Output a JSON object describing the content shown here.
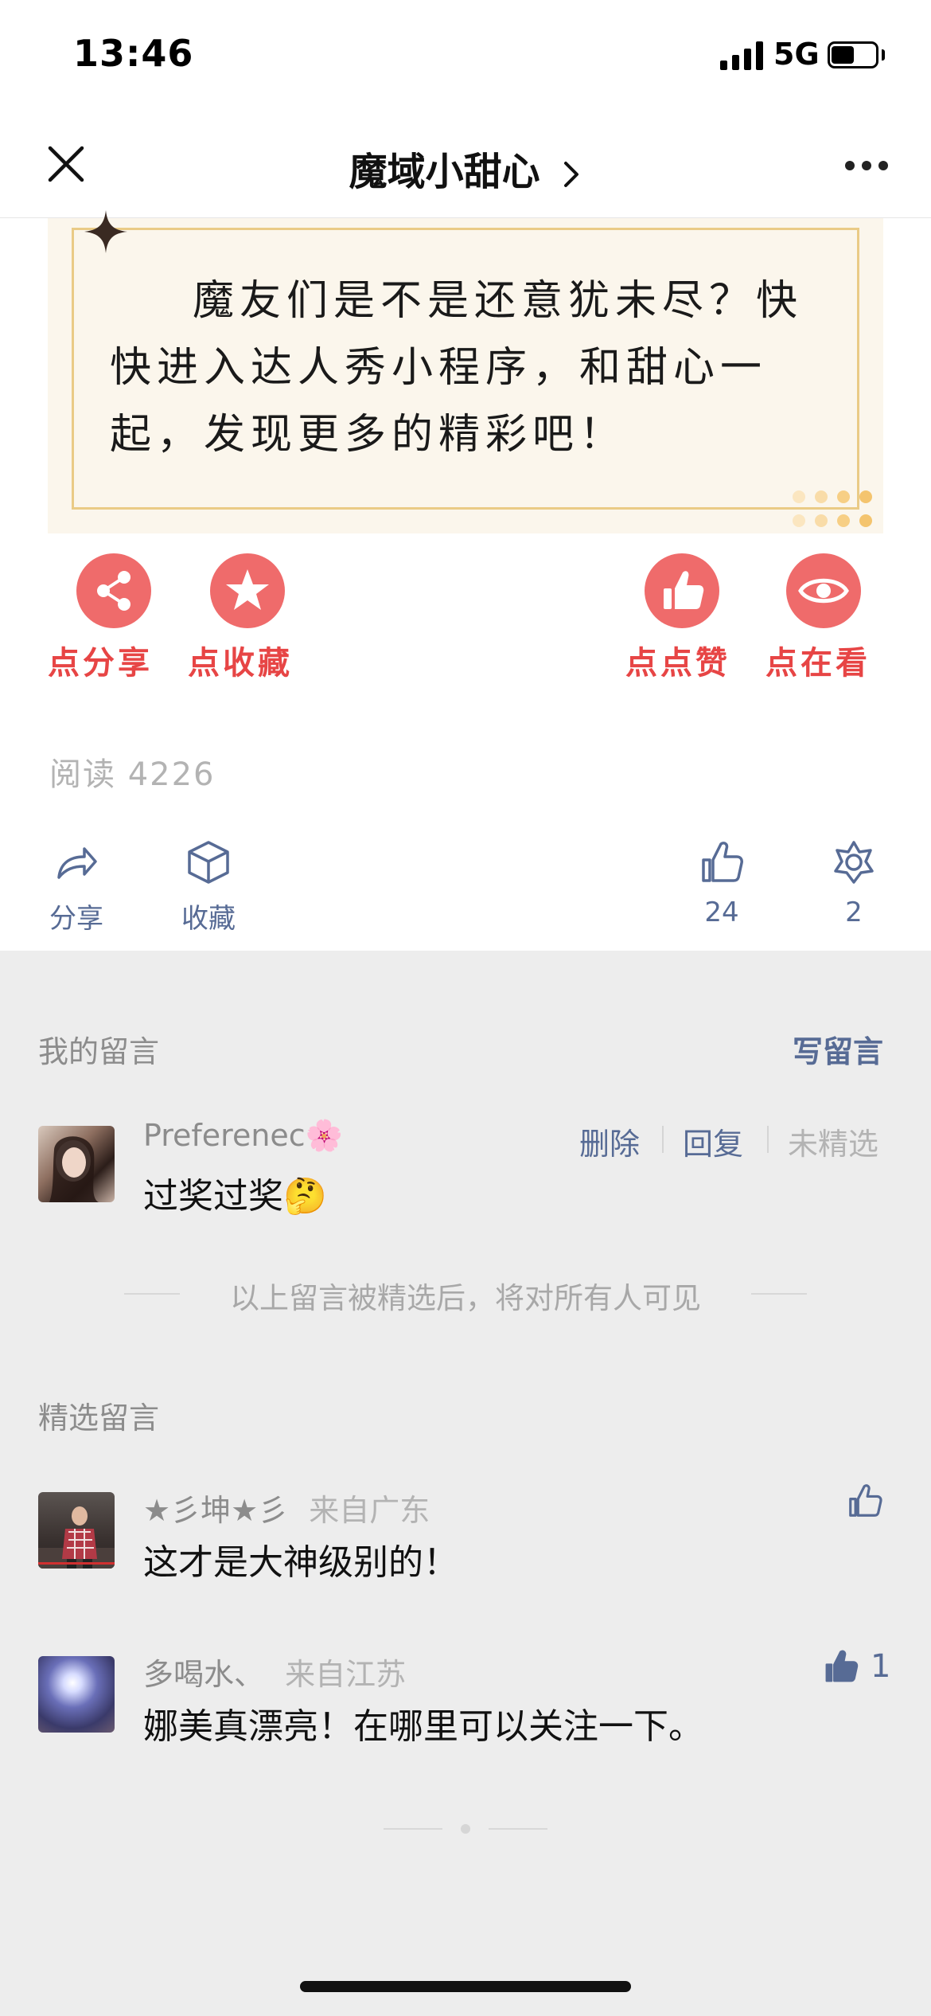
{
  "status_bar": {
    "time": "13:46",
    "network": "5G"
  },
  "nav": {
    "title": "魔域小甜心"
  },
  "article": {
    "card_text": "魔友们是不是还意犹未尽？快快进入达人秀小程序，和甜心一起，发现更多的精彩吧！",
    "actions": [
      "点分享",
      "点收藏",
      "点点赞",
      "点在看"
    ],
    "read_label": "阅读 4226"
  },
  "toolbar": {
    "share": "分享",
    "collect": "收藏",
    "like_count": "24",
    "wow_count": "2"
  },
  "my_comments": {
    "title": "我的留言",
    "write": "写留言",
    "item": {
      "name": "Preferenec",
      "flower": "🌸",
      "text": "过奖过奖",
      "emoji": "🤔",
      "delete": "删除",
      "reply": "回复",
      "featured_status": "未精选"
    },
    "notice": "以上留言被精选后，将对所有人可见"
  },
  "featured": {
    "title": "精选留言",
    "items": [
      {
        "name": "★彡坤★彡",
        "location": "来自广东",
        "text": "这才是大神级别的！",
        "likes": ""
      },
      {
        "name": "多喝水、",
        "location": "来自江苏",
        "text": "娜美真漂亮！在哪里可以关注一下。",
        "likes": "1"
      }
    ]
  },
  "colors": {
    "accent": "#576b95",
    "action_red": "#ef6b6b",
    "card_bg": "#fbf6ec",
    "card_border": "#eacb86"
  }
}
